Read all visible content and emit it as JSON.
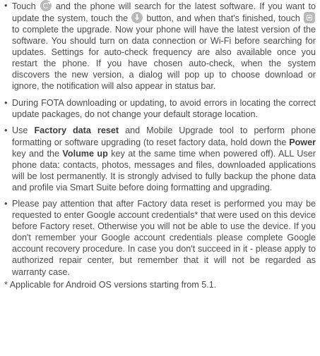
{
  "items": [
    {
      "t0": "Touch ",
      "t1": " and the phone will search for the latest software. If you want to update the system, touch the ",
      "t2": " button, and when that's finished, touch ",
      "t3": " to complete the upgrade. Now your phone will have the latest version of the software. You should turn on data connection or Wi-Fi before searching for updates. Settings for auto-check frequency are also available once you restart the phone. If you have chosen auto-check, when the system discovers the new version, a dialog will pop up to choose download or ignore, the notification will also appear in status bar.",
      "icons": [
        "refresh-icon",
        "download-icon",
        "install-icon"
      ]
    },
    {
      "t0": "During FOTA downloading or updating, to avoid errors in locating the correct update packages, do not change your default storage location."
    },
    {
      "t0": "Use ",
      "b0": "Factory data reset",
      "t1": " and Mobile Upgrade tool to perform phone formatting or software upgrading (to reset factory data, hold down the ",
      "b1": "Power",
      "t2": " key and the ",
      "b2": "Volume up",
      "t3": " key at the same time when powered off). ALL User phone data: contacts, photos, messages and files, downloaded applications  will be lost permanently. It is strongly advised to fully backup the phone data and profile via Smart Suite before doing formatting and upgrading."
    },
    {
      "t0": "Please pay attention that after Factory data reset is performed you may be requested to enter Google account credentials* that were used on this device before Factory reset. Otherwise you will not be able to use the device. If you don't remember your Google account credentials please complete Google account recovery procedure. In case you don't succeed in it - please apply to authorized repair center, but remember that it will not be regarded as warranty case."
    }
  ],
  "bullet": "•",
  "footnote": "* Applicable for Android OS versions starting from 5.1."
}
